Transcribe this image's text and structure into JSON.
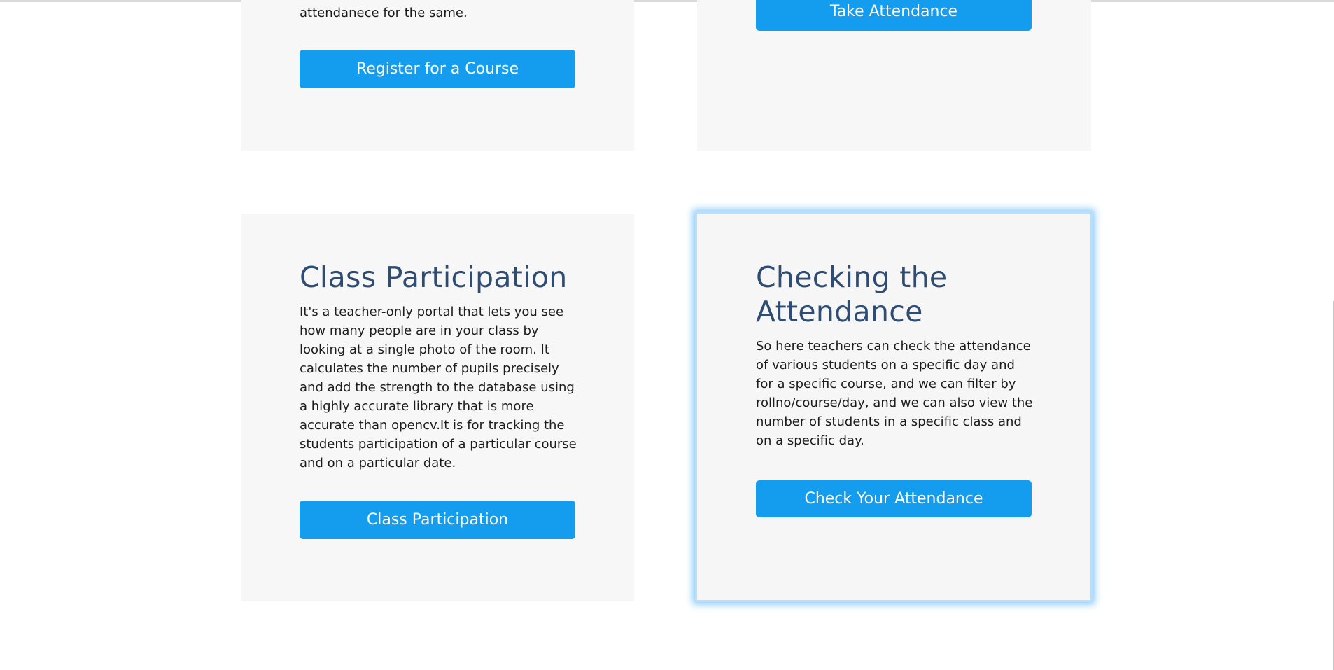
{
  "cards": {
    "register": {
      "text_tail": "attendanece for the same.",
      "button_label": "Register for a Course"
    },
    "take_attendance": {
      "button_label": "Take Attendance"
    },
    "class_participation": {
      "title": "Class Participation",
      "description": "It's a teacher-only portal that lets you see how many people are in your class by looking at a single photo of the room. It calculates the number of pupils precisely and add the strength to the database using a highly accurate library that is more accurate than opencv.It is for tracking the students participation of a particular course and on a particular date.",
      "button_label": "Class Participation"
    },
    "checking_attendance": {
      "title": "Checking the Attendance",
      "description": "So here teachers can check the attendance of various students on a specific day and for a specific course, and we can filter by rollno/course/day, and we can also view the number of students in a specific class and on a specific day.",
      "button_label": "Check Your Attendance"
    }
  },
  "colors": {
    "button_bg": "#149cef",
    "card_bg": "#f7f7f7",
    "title_color": "#2f4d73",
    "highlight_glow": "#5ab4f5"
  }
}
